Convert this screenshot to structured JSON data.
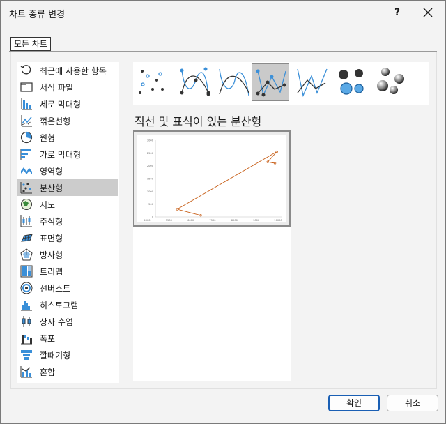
{
  "dialog": {
    "title": "차트 종류 변경",
    "help_label": "?",
    "tab_label": "모든 차트"
  },
  "categories": [
    {
      "label": "최근에 사용한 항목",
      "icon": "recent-icon",
      "selected": false
    },
    {
      "label": "서식 파일",
      "icon": "folder-icon",
      "selected": false
    },
    {
      "label": "세로 막대형",
      "icon": "column-chart-icon",
      "selected": false
    },
    {
      "label": "꺾은선형",
      "icon": "line-chart-icon",
      "selected": false
    },
    {
      "label": "원형",
      "icon": "pie-chart-icon",
      "selected": false
    },
    {
      "label": "가로 막대형",
      "icon": "bar-chart-icon",
      "selected": false
    },
    {
      "label": "영역형",
      "icon": "area-chart-icon",
      "selected": false
    },
    {
      "label": "분산형",
      "icon": "scatter-chart-icon",
      "selected": true
    },
    {
      "label": "지도",
      "icon": "map-chart-icon",
      "selected": false
    },
    {
      "label": "주식형",
      "icon": "stock-chart-icon",
      "selected": false
    },
    {
      "label": "표면형",
      "icon": "surface-chart-icon",
      "selected": false
    },
    {
      "label": "방사형",
      "icon": "radar-chart-icon",
      "selected": false
    },
    {
      "label": "트리맵",
      "icon": "treemap-chart-icon",
      "selected": false
    },
    {
      "label": "선버스트",
      "icon": "sunburst-chart-icon",
      "selected": false
    },
    {
      "label": "히스토그램",
      "icon": "histogram-chart-icon",
      "selected": false
    },
    {
      "label": "상자 수염",
      "icon": "box-whisker-chart-icon",
      "selected": false
    },
    {
      "label": "폭포",
      "icon": "waterfall-chart-icon",
      "selected": false
    },
    {
      "label": "깔때기형",
      "icon": "funnel-chart-icon",
      "selected": false
    },
    {
      "label": "혼합",
      "icon": "combo-chart-icon",
      "selected": false
    }
  ],
  "subtypes": [
    {
      "icon": "scatter-markers-icon",
      "selected": false
    },
    {
      "icon": "scatter-smooth-lines-markers-icon",
      "selected": false
    },
    {
      "icon": "scatter-smooth-lines-icon",
      "selected": false
    },
    {
      "icon": "scatter-straight-lines-markers-icon",
      "selected": true
    },
    {
      "icon": "scatter-straight-lines-icon",
      "selected": false
    },
    {
      "icon": "bubble-icon",
      "selected": false
    },
    {
      "icon": "bubble-3d-icon",
      "selected": false
    }
  ],
  "selected_subtype_title": "직선 및 표식이 있는 분산형",
  "chart_data": {
    "type": "scatter",
    "series": [
      {
        "points": [
          [
            4700,
            300
          ],
          [
            6000,
            60
          ],
          [
            4700,
            300
          ],
          [
            10200,
            2550
          ],
          [
            9700,
            2150
          ],
          [
            10100,
            2100
          ]
        ],
        "color": "#c65a11"
      }
    ],
    "xticks": [
      "4000",
      "5500",
      "6000",
      "7500",
      "8000",
      "9000",
      "10000"
    ],
    "yticks": [
      "3000",
      "2500",
      "2000",
      "1500",
      "1000",
      "500",
      "0"
    ],
    "xlim": [
      3500,
      10500
    ],
    "ylim": [
      0,
      3000
    ]
  },
  "buttons": {
    "ok": "확인",
    "cancel": "취소"
  }
}
